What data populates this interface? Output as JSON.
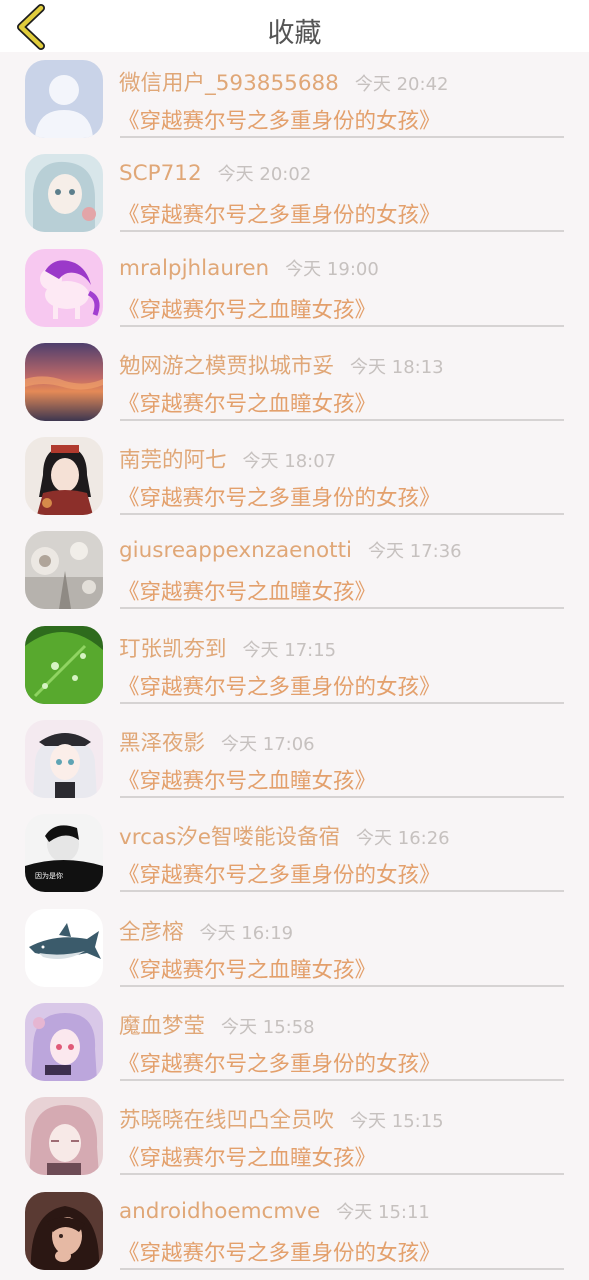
{
  "header": {
    "title": "收藏",
    "back_icon": "chevron-left-icon",
    "back_color": "#e1cd3c"
  },
  "colors": {
    "name": "#e0a777",
    "time": "#c6c1bf",
    "book": "#e3a06c",
    "divider": "#d6d3d3"
  },
  "items": [
    {
      "name": "微信用户_593855688",
      "time": "今天 20:42",
      "book": "《穿越赛尔号之多重身份的女孩》",
      "avatar": "default-person"
    },
    {
      "name": "SCP712",
      "time": "今天 20:02",
      "book": "《穿越赛尔号之多重身份的女孩》",
      "avatar": "anime-girl-blue"
    },
    {
      "name": "mralpjhlauren",
      "time": "今天 19:00",
      "book": "《穿越赛尔号之血瞳女孩》",
      "avatar": "pink-unicorn"
    },
    {
      "name": "勉网游之模贾拟城市妥",
      "time": "今天 18:13",
      "book": "《穿越赛尔号之血瞳女孩》",
      "avatar": "sunset-sky"
    },
    {
      "name": "南莞的阿七",
      "time": "今天 18:07",
      "book": "《穿越赛尔号之多重身份的女孩》",
      "avatar": "kimono-girl"
    },
    {
      "name": "giusreappexnzaenotti",
      "time": "今天 17:36",
      "book": "《穿越赛尔号之血瞳女孩》",
      "avatar": "lace-ornament"
    },
    {
      "name": "玎张凯夯到",
      "time": "今天 17:15",
      "book": "《穿越赛尔号之多重身份的女孩》",
      "avatar": "green-leaf"
    },
    {
      "name": "黑泽夜影",
      "time": "今天 17:06",
      "book": "《穿越赛尔号之血瞳女孩》",
      "avatar": "anime-girl-hat"
    },
    {
      "name": "vrcas汐e智喽能设备宿",
      "time": "今天 16:26",
      "book": "《穿越赛尔号之多重身份的女孩》",
      "avatar": "boy-bw"
    },
    {
      "name": "全彦榕",
      "time": "今天 16:19",
      "book": "《穿越赛尔号之血瞳女孩》",
      "avatar": "shark"
    },
    {
      "name": "魔血梦莹",
      "time": "今天 15:58",
      "book": "《穿越赛尔号之多重身份的女孩》",
      "avatar": "anime-girl-purple"
    },
    {
      "name": "苏晓晓在线凹凸全员吹",
      "time": "今天 15:15",
      "book": "《穿越赛尔号之血瞳女孩》",
      "avatar": "anime-girl-pink"
    },
    {
      "name": "androidhoemcmve",
      "time": "今天 15:11",
      "book": "《穿越赛尔号之多重身份的女孩》",
      "avatar": "girl-hair"
    }
  ]
}
